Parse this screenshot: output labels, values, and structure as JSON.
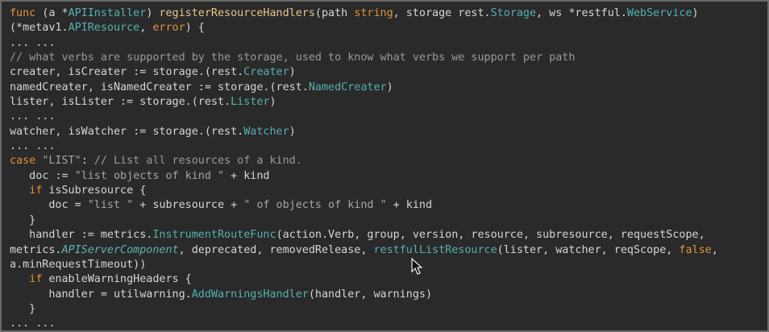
{
  "colors": {
    "background": "#2a2a2a",
    "keyword": "#e0943a",
    "type": "#56b0b0",
    "ident": "#d6d6d6",
    "string": "#a5a5a5",
    "comment": "#9a9a9a",
    "func": "#e6c88b"
  },
  "cursor_icon": "mouse-pointer-icon",
  "code_lines": [
    [
      {
        "t": "func",
        "c": "keyword"
      },
      {
        "t": " (a *",
        "c": "ident"
      },
      {
        "t": "APIInstaller",
        "c": "type"
      },
      {
        "t": ") ",
        "c": "ident"
      },
      {
        "t": "registerResourceHandlers",
        "c": "func"
      },
      {
        "t": "(path ",
        "c": "ident"
      },
      {
        "t": "string",
        "c": "keyword"
      },
      {
        "t": ", storage rest.",
        "c": "ident"
      },
      {
        "t": "Storage",
        "c": "type"
      },
      {
        "t": ", ws *restful.",
        "c": "ident"
      },
      {
        "t": "WebService",
        "c": "type"
      },
      {
        "t": ")",
        "c": "ident"
      }
    ],
    [
      {
        "t": "(*metav1.",
        "c": "ident"
      },
      {
        "t": "APIResource",
        "c": "type"
      },
      {
        "t": ", ",
        "c": "ident"
      },
      {
        "t": "error",
        "c": "keyword"
      },
      {
        "t": ") {",
        "c": "ident"
      }
    ],
    [
      {
        "t": "... ...",
        "c": "ident"
      }
    ],
    [
      {
        "t": "// what verbs are supported by the storage, used to know what verbs we support per path",
        "c": "comment"
      }
    ],
    [
      {
        "t": "creater, isCreater := storage.(rest.",
        "c": "ident"
      },
      {
        "t": "Creater",
        "c": "type"
      },
      {
        "t": ")",
        "c": "ident"
      }
    ],
    [
      {
        "t": "namedCreater, isNamedCreater := storage.(rest.",
        "c": "ident"
      },
      {
        "t": "NamedCreater",
        "c": "type"
      },
      {
        "t": ")",
        "c": "ident"
      }
    ],
    [
      {
        "t": "lister, isLister := storage.(rest.",
        "c": "ident"
      },
      {
        "t": "Lister",
        "c": "type"
      },
      {
        "t": ")",
        "c": "ident"
      }
    ],
    [
      {
        "t": "... ...",
        "c": "ident"
      }
    ],
    [
      {
        "t": "watcher, isWatcher := storage.(rest.",
        "c": "ident"
      },
      {
        "t": "Watcher",
        "c": "type"
      },
      {
        "t": ")",
        "c": "ident"
      }
    ],
    [
      {
        "t": "... ...",
        "c": "ident"
      }
    ],
    [
      {
        "t": "case",
        "c": "keyword"
      },
      {
        "t": " ",
        "c": "ident"
      },
      {
        "t": "\"LIST\"",
        "c": "string"
      },
      {
        "t": ": ",
        "c": "ident"
      },
      {
        "t": "// List all resources of a kind.",
        "c": "comment"
      }
    ],
    [
      {
        "t": "   doc := ",
        "c": "ident"
      },
      {
        "t": "\"list objects of kind \"",
        "c": "string"
      },
      {
        "t": " + kind",
        "c": "ident"
      }
    ],
    [
      {
        "t": "   ",
        "c": "ident"
      },
      {
        "t": "if",
        "c": "keyword"
      },
      {
        "t": " isSubresource {",
        "c": "ident"
      }
    ],
    [
      {
        "t": "      doc = ",
        "c": "ident"
      },
      {
        "t": "\"list \"",
        "c": "string"
      },
      {
        "t": " + subresource + ",
        "c": "ident"
      },
      {
        "t": "\" of objects of kind \"",
        "c": "string"
      },
      {
        "t": " + kind",
        "c": "ident"
      }
    ],
    [
      {
        "t": "   }",
        "c": "ident"
      }
    ],
    [
      {
        "t": "   handler := metrics.",
        "c": "ident"
      },
      {
        "t": "InstrumentRouteFunc",
        "c": "type"
      },
      {
        "t": "(action.Verb, group, version, resource, subresource, requestScope,",
        "c": "ident"
      }
    ],
    [
      {
        "t": "metrics.",
        "c": "ident"
      },
      {
        "t": "APIServerComponent",
        "c": "italic"
      },
      {
        "t": ", deprecated, removedRelease, ",
        "c": "ident"
      },
      {
        "t": "restfulListResource",
        "c": "type"
      },
      {
        "t": "(lister, watcher, reqScope, ",
        "c": "ident"
      },
      {
        "t": "false",
        "c": "keyword"
      },
      {
        "t": ",",
        "c": "ident"
      }
    ],
    [
      {
        "t": "a.minRequestTimeout))",
        "c": "ident"
      }
    ],
    [
      {
        "t": "   ",
        "c": "ident"
      },
      {
        "t": "if",
        "c": "keyword"
      },
      {
        "t": " enableWarningHeaders {",
        "c": "ident"
      }
    ],
    [
      {
        "t": "      handler = utilwarning.",
        "c": "ident"
      },
      {
        "t": "AddWarningsHandler",
        "c": "type"
      },
      {
        "t": "(handler, warnings)",
        "c": "ident"
      }
    ],
    [
      {
        "t": "   }",
        "c": "ident"
      }
    ],
    [
      {
        "t": "... ...",
        "c": "ident"
      }
    ]
  ]
}
